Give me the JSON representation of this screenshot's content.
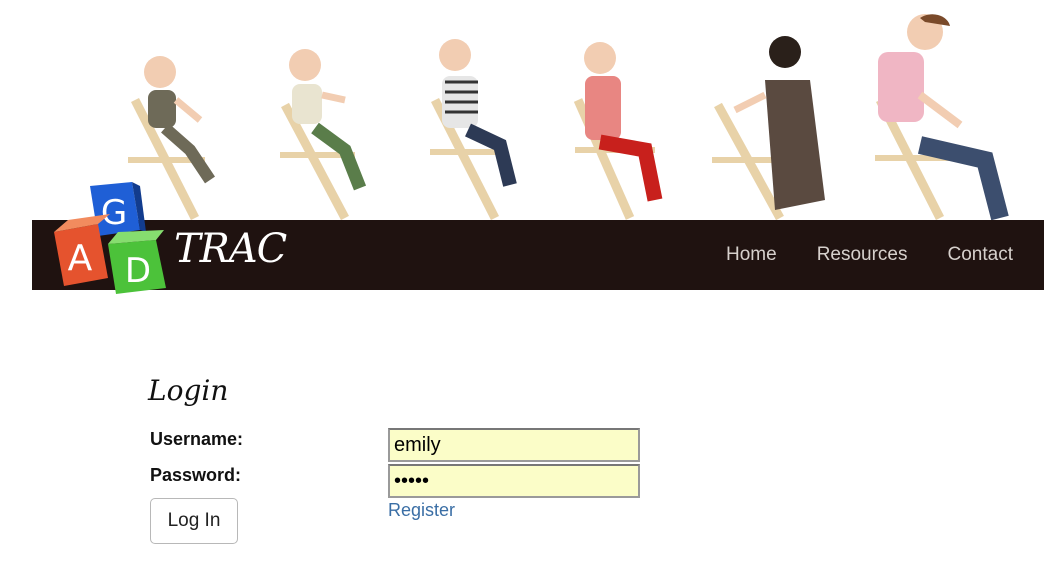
{
  "header": {
    "brand": "TRAC",
    "logo_letters": [
      "A",
      "G",
      "D"
    ],
    "nav": [
      {
        "label": "Home"
      },
      {
        "label": "Resources"
      },
      {
        "label": "Contact"
      }
    ]
  },
  "login": {
    "title": "Login",
    "username_label": "Username:",
    "username_value": "emily",
    "password_label": "Password:",
    "password_value": "•••••",
    "submit_label": "Log In",
    "register_label": "Register"
  },
  "colors": {
    "navbar_bg": "#1f1210",
    "input_bg": "#fbfdc8",
    "link": "#3a6ea5",
    "cube_red": "#e5532e",
    "cube_blue": "#1f5fd6",
    "cube_green": "#4cc23a"
  }
}
